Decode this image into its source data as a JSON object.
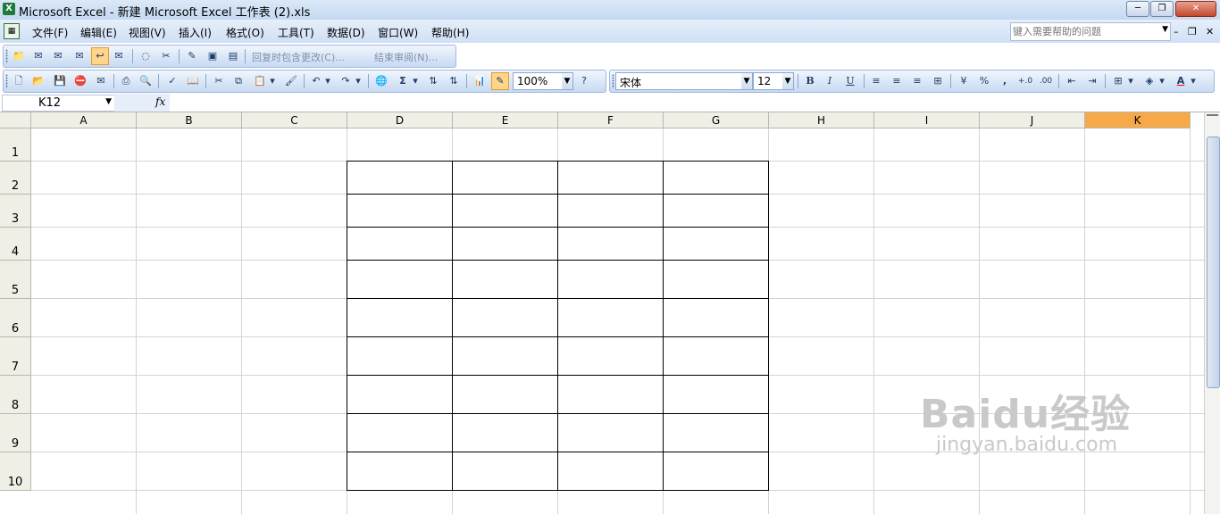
{
  "window": {
    "title": "Microsoft Excel - 新建 Microsoft Excel 工作表 (2).xls",
    "minimize": "─",
    "restore": "❐",
    "close": "✕"
  },
  "menu": {
    "items": [
      "文件(F)",
      "编辑(E)",
      "视图(V)",
      "插入(I)",
      "格式(O)",
      "工具(T)",
      "数据(D)",
      "窗口(W)",
      "帮助(H)"
    ],
    "help_placeholder": "键入需要帮助的问题",
    "doc_minimize": "–",
    "doc_restore": "❐",
    "doc_close": "✕"
  },
  "review_toolbar": {
    "reply_label": "回复时包含更改(C)...",
    "end_review_label": "结束审阅(N)..."
  },
  "standard_toolbar": {
    "zoom": "100%",
    "sum_symbol": "Σ"
  },
  "format_toolbar": {
    "font_name": "宋体",
    "font_size": "12",
    "bold": "B",
    "italic": "I",
    "underline": "U",
    "percent": "%",
    "comma": ",",
    "font_color_letter": "A"
  },
  "formula_bar": {
    "name_box": "K12",
    "fx_label": "fx",
    "formula": ""
  },
  "sheet": {
    "columns": [
      "A",
      "B",
      "C",
      "D",
      "E",
      "F",
      "G",
      "H",
      "I",
      "J",
      "K"
    ],
    "selected_column": "K",
    "rows": [
      "1",
      "2",
      "3",
      "4",
      "5",
      "6",
      "7",
      "8",
      "9",
      "10"
    ]
  },
  "watermark": {
    "brand": "Baidu经验",
    "url": "jingyan.baidu.com"
  }
}
